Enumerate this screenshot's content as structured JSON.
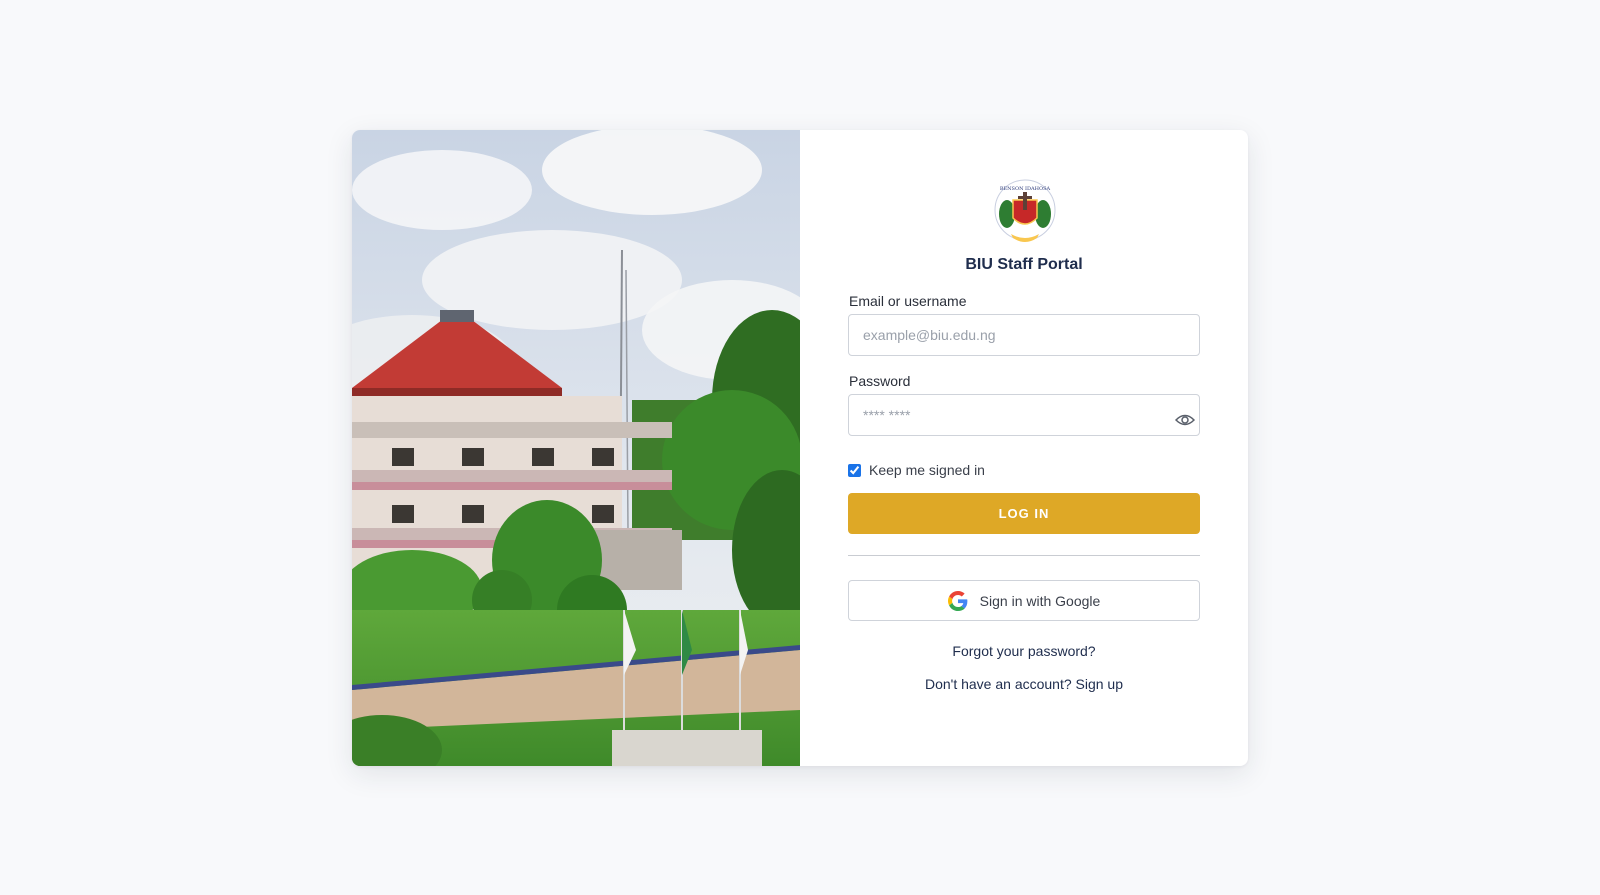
{
  "hero": {
    "image_description_icon": "campus-building-photo"
  },
  "brand": {
    "logo_icon": "university-crest-logo",
    "logo_text": "BENSON IDAHOSA UNIVERSITY",
    "title": "BIU Staff Portal"
  },
  "form": {
    "email_label": "Email or username",
    "email_placeholder": "example@biu.edu.ng",
    "email_value": "",
    "password_label": "Password",
    "password_placeholder": "**** ****",
    "password_value": "",
    "toggle_icon": "eye-icon",
    "remember_label": "Keep me signed in",
    "remember_checked": true,
    "login_label": "LOG IN",
    "google_label": "Sign in with Google",
    "google_icon": "google-g-icon",
    "forgot_label": "Forgot your password?",
    "signup_label": "Don't have an account? Sign up"
  },
  "colors": {
    "accent": "#dea826",
    "title_text": "#1f2d4d",
    "page_background": "#f8f9fb"
  }
}
